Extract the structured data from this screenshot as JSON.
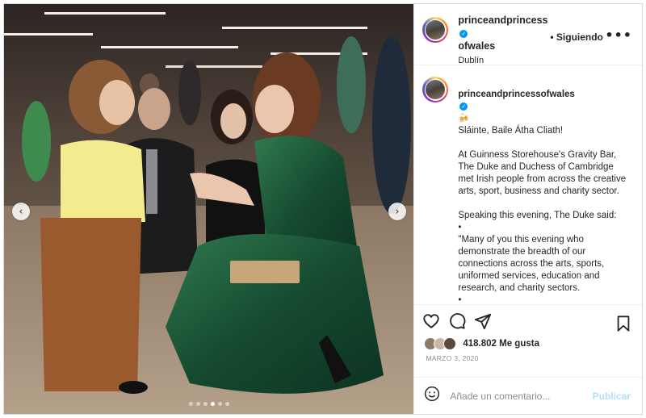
{
  "post": {
    "username": "princeandprincessofwales",
    "username_line1": "princeandprincess",
    "username_line2": "ofwales",
    "location": "Dublín",
    "follow_status": "• Siguiendo",
    "more_label": "•••"
  },
  "caption": {
    "username": "princeandprincessofwales",
    "emoji": "🍻",
    "paragraphs": [
      "Sláinte, Baile Átha Cliath!",
      "At Guinness Storehouse's Gravity Bar, The Duke and Duchess of Cambridge met Irish people from across the creative arts, sport, business and charity sector.",
      "Speaking this evening, The Duke said:\n•\n\"Many of you this evening who demonstrate the breadth of our connections across the arts, sports, uniformed services, education and research, and charity sectors.\n•\nWe value it as we do your friendship and are committed to strengthening it"
    ]
  },
  "engagement": {
    "likes": "418.802 Me gusta",
    "date": "MARZO 3, 2020"
  },
  "comment": {
    "placeholder": "Añade un comentario...",
    "publish_label": "Publicar"
  },
  "carousel": {
    "prev_glyph": "‹",
    "next_glyph": "›",
    "dots": 6,
    "active_dot": 3
  },
  "icons": {
    "heart": "heart-icon",
    "comment": "comment-icon",
    "share": "share-icon",
    "bookmark": "bookmark-icon",
    "emoji": "emoji-icon",
    "verified": "verified-icon"
  },
  "colors": {
    "accent_blue": "#0095f6",
    "publish_disabled": "#b2dffc",
    "dress_green": "#1f5a3c"
  }
}
